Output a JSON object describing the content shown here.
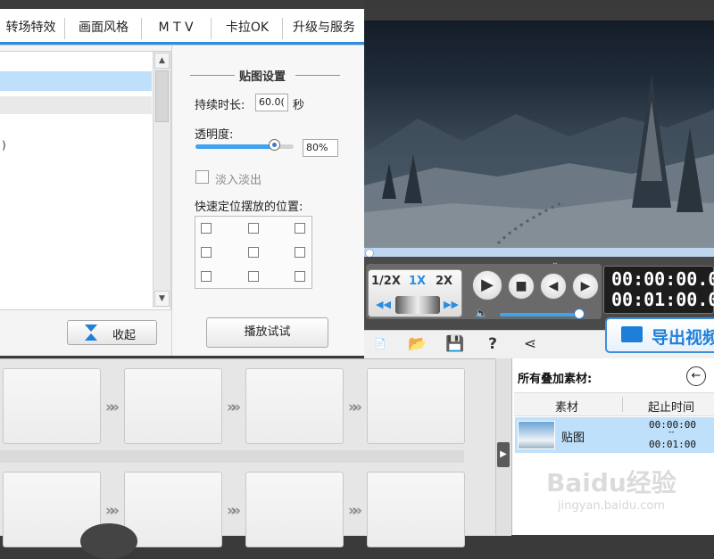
{
  "tabs": [
    "转场特效",
    "画面风格",
    "M T V",
    "卡拉OK",
    "升级与服务"
  ],
  "left_panel": {
    "list_partial_text": ")",
    "collapse_label": "收起"
  },
  "sticker_settings": {
    "title": "贴图设置",
    "duration_label": "持续时长:",
    "duration_value": "60.0(",
    "duration_unit": "秒",
    "opacity_label": "透明度:",
    "opacity_value": "80%",
    "opacity_fraction": 0.8,
    "fade_label": "淡入淡出",
    "fade_checked": false,
    "position_label": "快速定位摆放的位置:",
    "preview_button": "播放试试"
  },
  "player": {
    "speeds": [
      "1/2X",
      "1X",
      "2X"
    ],
    "active_speed": "1X",
    "current_time": "00:00:00.0",
    "total_time": "00:01:00.0",
    "export_label": "导出视频"
  },
  "toolbar_icons": [
    "new-icon",
    "open-folder-icon",
    "save-icon",
    "help-icon",
    "share-icon"
  ],
  "overlay_panel": {
    "title": "所有叠加素材:",
    "col_material": "素材",
    "col_time": "起止时间",
    "item_name": "贴图",
    "item_start": "00:00:00",
    "item_end": "00:01:00"
  },
  "watermark": {
    "main": "Baidu经验",
    "sub": "jingyan.baidu.com"
  },
  "colors": {
    "accent": "#2a8de0",
    "selection": "#bfe0fb",
    "export": "#1e7fd9"
  }
}
